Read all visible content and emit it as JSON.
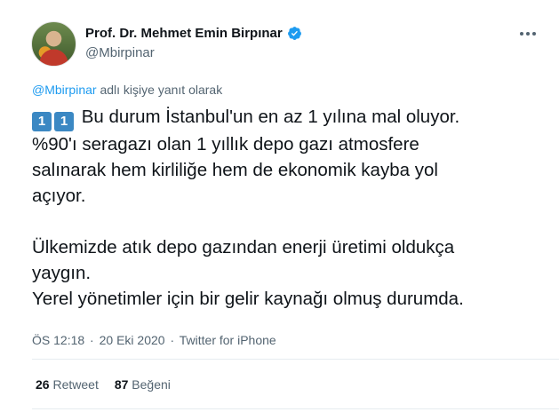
{
  "author": {
    "name": "Prof. Dr. Mehmet Emin Birpınar",
    "handle": "@Mbirpinar"
  },
  "reply": {
    "mention": "@Mbirpinar",
    "text": "adlı kişiye yanıt olarak"
  },
  "tweet": {
    "keycaps": [
      "1",
      "1"
    ],
    "paragraph1_line1": "Bu durum İstanbul'un en az 1 yılına mal oluyor.",
    "paragraph1_line2": "%90'ı seragazı olan 1 yıllık depo gazı atmosfere",
    "paragraph1_line3": "salınarak hem kirliliğe hem de ekonomik kayba yol",
    "paragraph1_line4": "açıyor.",
    "paragraph2_line1": "Ülkemizde atık depo gazından enerji üretimi oldukça",
    "paragraph2_line2": "yaygın.",
    "paragraph2_line3": "Yerel yönetimler için bir gelir kaynağı olmuş durumda."
  },
  "meta": {
    "time": "ÖS 12:18",
    "date": "20 Eki 2020",
    "separator": "·",
    "source": "Twitter for iPhone"
  },
  "stats": {
    "retweets": "26",
    "retweets_label": "Retweet",
    "likes": "87",
    "likes_label": "Beğeni"
  },
  "colors": {
    "accent": "#1d9bf0",
    "secondary_text": "#536471",
    "keycap": "#3b88c3"
  },
  "icons": [
    "verified-badge-icon",
    "more-options-icon",
    "keycap-one-icon"
  ]
}
